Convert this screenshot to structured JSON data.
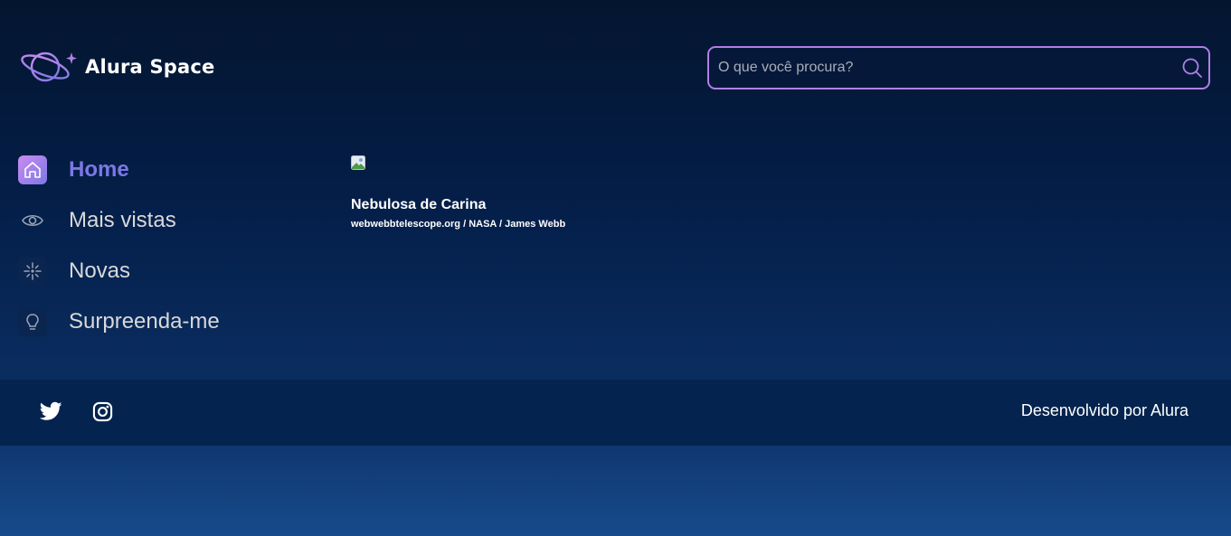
{
  "header": {
    "logo_text": "Alura Space",
    "search": {
      "placeholder": "O que você procura?",
      "value": ""
    }
  },
  "colors": {
    "accent_purple": "#b07fe6",
    "active_nav": "#7b78e5",
    "footer_bg": "#04244f"
  },
  "sidebar": {
    "items": [
      {
        "label": "Home",
        "icon": "home-icon",
        "active": true
      },
      {
        "label": "Mais vistas",
        "icon": "eye-icon",
        "active": false
      },
      {
        "label": "Novas",
        "icon": "sparkle-icon",
        "active": false
      },
      {
        "label": "Surpreenda-me",
        "icon": "lightbulb-icon",
        "active": false
      }
    ]
  },
  "gallery": {
    "items": [
      {
        "title": "Nebulosa de Carina",
        "credit": "webwebbtelescope.org / NASA / James Webb"
      }
    ]
  },
  "footer": {
    "socials": [
      "twitter-icon",
      "instagram-icon"
    ],
    "credit": "Desenvolvido por Alura"
  }
}
